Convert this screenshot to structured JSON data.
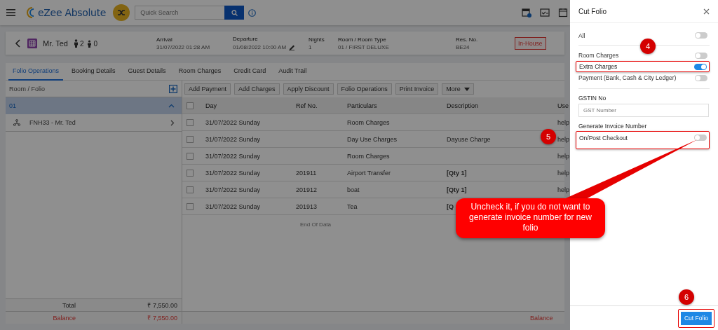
{
  "app_bar": {
    "logo_text": "eZee Absolute",
    "search": {
      "placeholder": "Quick Search"
    }
  },
  "booking": {
    "guest": "Mr. Ted",
    "adults": "2",
    "children": "0",
    "fields": [
      {
        "label": "Arrival",
        "value": "31/07/2022 01:28 AM",
        "editable": false
      },
      {
        "label": "Departure",
        "value": "01/08/2022 10:00 AM",
        "editable": true
      },
      {
        "label": "Nights",
        "value": "1",
        "editable": false
      },
      {
        "label": "Room / Room Type",
        "value": "01 / FIRST DELUXE",
        "editable": false
      },
      {
        "label": "Res. No.",
        "value": "BE24",
        "editable": false
      }
    ],
    "status": "In-House"
  },
  "tabs": [
    {
      "label": "Folio Operations",
      "selected": true
    },
    {
      "label": "Booking Details",
      "selected": false
    },
    {
      "label": "Guest Details",
      "selected": false
    },
    {
      "label": "Room Charges",
      "selected": false
    },
    {
      "label": "Credit Card",
      "selected": false
    },
    {
      "label": "Audit Trail",
      "selected": false
    }
  ],
  "folio_list": {
    "title": "Room / Folio",
    "rooms": [
      {
        "label": "01",
        "selected": true,
        "expanded": true,
        "children": [
          {
            "label": "FNH33 - Mr. Ted",
            "selected": false
          }
        ]
      }
    ],
    "total_label": "Total",
    "total": "₹ 7,550.00",
    "balance_label": "Balance",
    "balance": "₹ 7,550.00"
  },
  "toolbar": [
    {
      "label": "Add Payment",
      "kind": "button"
    },
    {
      "label": "Add Charges",
      "kind": "button"
    },
    {
      "label": "Apply Discount",
      "kind": "button"
    },
    {
      "label": "Folio Operations",
      "kind": "button"
    },
    {
      "label": "Print Invoice",
      "kind": "button"
    },
    {
      "label": "More",
      "kind": "dropdown"
    }
  ],
  "table": {
    "select_all_checked": false,
    "columns": [
      "Day",
      "Ref No.",
      "Particulars",
      "Description",
      "Use"
    ],
    "rows": [
      {
        "checked": false,
        "cells": [
          "31/07/2022 Sunday",
          "",
          "Room Charges",
          "",
          "help"
        ]
      },
      {
        "checked": false,
        "cells": [
          "31/07/2022 Sunday",
          "",
          "Day Use Charges",
          "Dayuse Charge",
          "help"
        ],
        "description_bold": false
      },
      {
        "checked": false,
        "cells": [
          "31/07/2022 Sunday",
          "",
          "Room Charges",
          "",
          "help"
        ]
      },
      {
        "checked": false,
        "cells": [
          "31/07/2022 Sunday",
          "201911",
          "Airport Transfer",
          "[Qty 1]",
          "help"
        ],
        "description_bold": true
      },
      {
        "checked": false,
        "cells": [
          "31/07/2022 Sunday",
          "201912",
          "boat",
          "[Qty 1]",
          "help"
        ],
        "description_bold": true
      },
      {
        "checked": false,
        "cells": [
          "31/07/2022 Sunday",
          "201913",
          "Tea",
          "[Q",
          ""
        ],
        "description_bold": true
      }
    ],
    "end_note": "End Of Data",
    "footer_label": "Balance"
  },
  "panel": {
    "title": "Cut Folio",
    "toggles": [
      {
        "label": "All",
        "on": false,
        "highlighted": false
      },
      {
        "label": "Room Charges",
        "on": false,
        "highlighted": false
      },
      {
        "label": "Extra Charges",
        "on": true,
        "highlighted": true
      },
      {
        "label": "Payment (Bank, Cash & City Ledger)",
        "on": false,
        "highlighted": false
      }
    ],
    "gstin": {
      "label": "GSTIN No",
      "placeholder": "GST Number"
    },
    "invoice_heading": "Generate Invoice Number",
    "invoice_toggle": {
      "label": "On/Post Checkout",
      "on": false,
      "highlighted": true
    },
    "submit": {
      "label": "Cut Folio",
      "highlighted": true
    }
  },
  "annotations": {
    "steps": [
      {
        "number": "4"
      },
      {
        "number": "5"
      },
      {
        "number": "6"
      }
    ],
    "callout": "Uncheck it, if you do not want to generate invoice number for new folio"
  }
}
